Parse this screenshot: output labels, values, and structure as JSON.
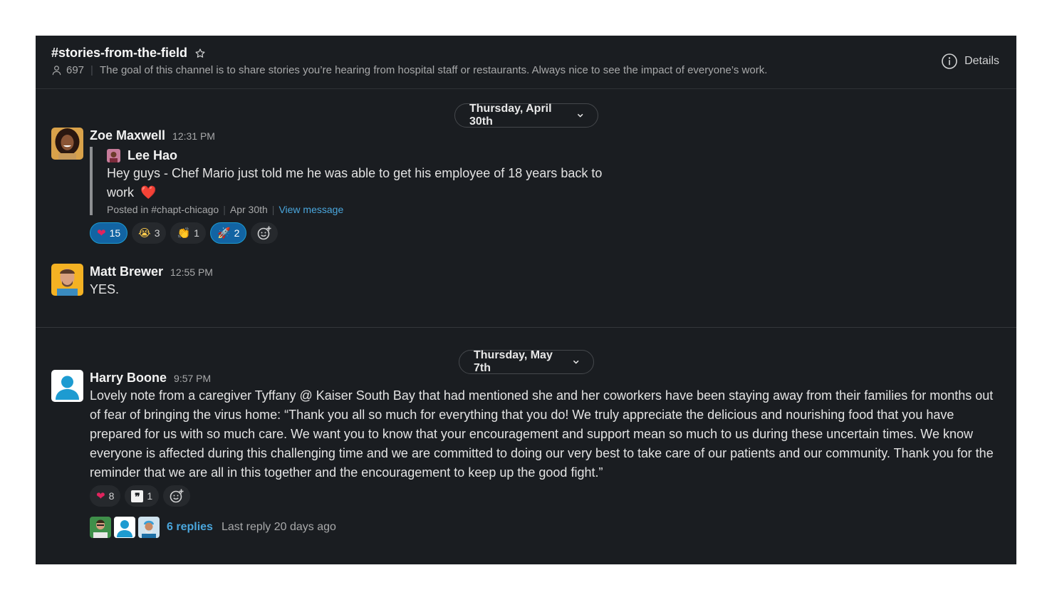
{
  "channel": {
    "name": "#stories-from-the-field",
    "member_count": "697",
    "topic": "The goal of this channel is to share stories you’re hearing from hospital staff or restaurants. Always nice to see the impact of everyone’s work.",
    "details_label": "Details"
  },
  "days": [
    {
      "date_label": "Thursday, April 30th",
      "messages": [
        {
          "sender": "Zoe Maxwell",
          "time": "12:31 PM",
          "shared": {
            "author": "Lee Hao",
            "text_line1": "Hey guys - Chef Mario just told me he was able to get his employee of 18 years back to",
            "text_line2": "work",
            "text_emoji": "❤️",
            "posted_in": "Posted in #chapt-chicago",
            "date": "Apr 30th",
            "view_link": "View message"
          },
          "reactions": [
            {
              "emoji": "❤",
              "count": "15",
              "active": true
            },
            {
              "emoji": "😭",
              "count": "3",
              "active": false
            },
            {
              "emoji": "👏",
              "count": "1",
              "active": false
            },
            {
              "emoji": "🚀",
              "count": "2",
              "active": true
            }
          ]
        },
        {
          "sender": "Matt Brewer",
          "time": "12:55 PM",
          "text": "YES."
        }
      ]
    },
    {
      "date_label": "Thursday, May 7th",
      "messages": [
        {
          "sender": "Harry Boone",
          "time": "9:57 PM",
          "text": "Lovely note from a caregiver Tyffany @ Kaiser South Bay that had mentioned she and her coworkers have been staying away from their families for months out of fear of bringing the virus home: “Thank you all so much for everything that you do! We truly appreciate the delicious and nourishing food that you have prepared for us with so much care. We want you to know that your encouragement and support mean so much to us during these uncertain times. We know everyone is affected during this challenging time and we are committed to doing our very best to take care of our patients and our community. Thank you for the reminder that we are all in this together and the encouragement to keep up the good fight.”",
          "reactions": [
            {
              "emoji": "❤",
              "count": "8",
              "active": false
            },
            {
              "emoji": "❞",
              "count": "1",
              "active": false
            }
          ],
          "thread": {
            "replies": "6 replies",
            "last_reply": "Last reply 20 days ago"
          }
        }
      ]
    }
  ],
  "colors": {
    "background": "#1a1d21",
    "accent_link": "#4aa6dc",
    "active_reaction": "#1264a3"
  },
  "icons": [
    "star-icon",
    "member-icon",
    "info-icon",
    "chevron-down-icon",
    "add-reaction-icon"
  ]
}
